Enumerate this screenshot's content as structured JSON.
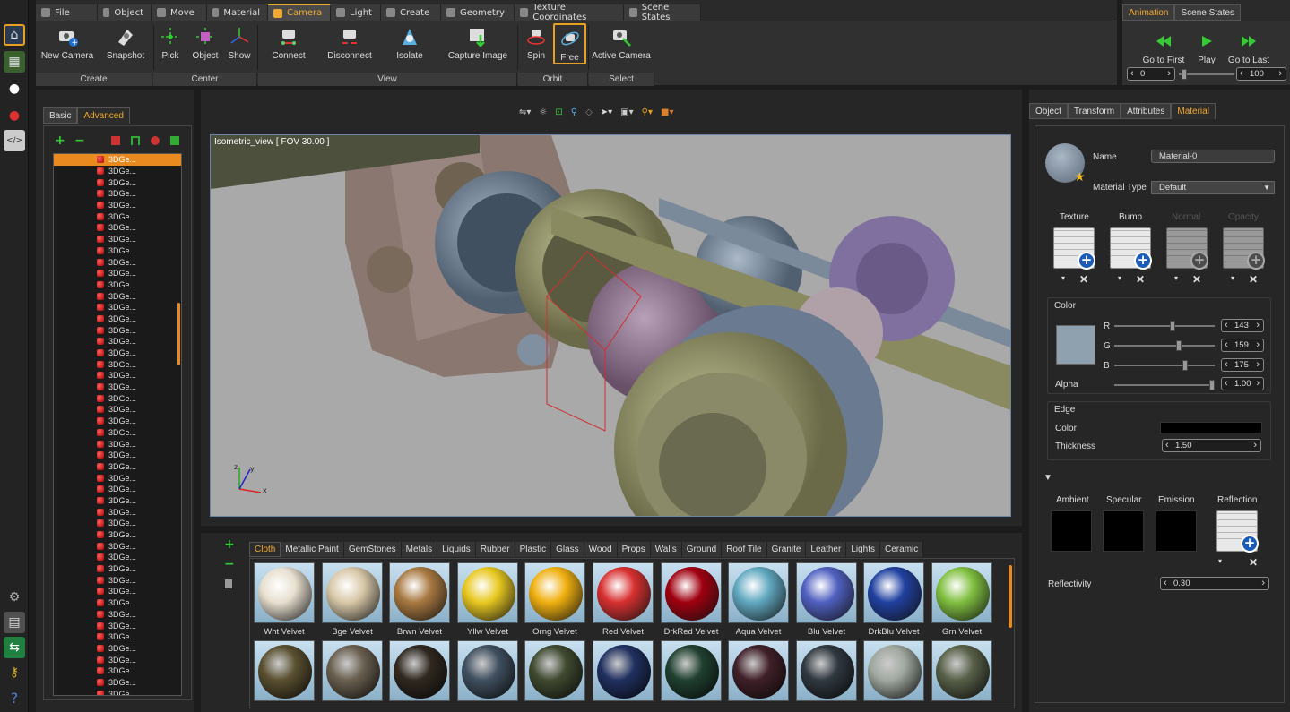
{
  "ribbon": {
    "tabs": [
      "File",
      "Object",
      "Move",
      "Material",
      "Camera",
      "Light",
      "Create",
      "Geometry",
      "Texture Coordinates",
      "Scene States"
    ],
    "active_tab": "Camera",
    "buttons": [
      "New Camera",
      "Snapshot",
      "Pick",
      "Object",
      "Show",
      "Connect",
      "Disconnect",
      "Isolate",
      "Capture Image",
      "Spin",
      "Free",
      "Active Camera"
    ],
    "groups": [
      "Create",
      "Center",
      "View",
      "Orbit",
      "Select"
    ]
  },
  "animation": {
    "tabs": [
      "Animation",
      "Scene States"
    ],
    "buttons": [
      "Go to First",
      "Play",
      "Go to Last"
    ],
    "start": "0",
    "end": "100"
  },
  "left_panel": {
    "tabs": [
      "Basic",
      "Advanced"
    ],
    "tree_item": "3DGe..."
  },
  "viewport": {
    "label": "Isometric_view [ FOV 30.00 ]",
    "axes": {
      "z": "z",
      "y": "y",
      "x": "x"
    }
  },
  "library": {
    "tabs": [
      "Cloth",
      "Metallic Paint",
      "GemStones",
      "Metals",
      "Liquids",
      "Rubber",
      "Plastic",
      "Glass",
      "Wood",
      "Props",
      "Walls",
      "Ground",
      "Roof Tile",
      "Granite",
      "Leather",
      "Lights",
      "Ceramic"
    ],
    "materials": [
      "Wht Velvet",
      "Bge Velvet",
      "Brwn Velvet",
      "Yllw Velvet",
      "Orng Velvet",
      "Red Velvet",
      "DrkRed Velvet",
      "Aqua Velvet",
      "Blu Velvet",
      "DrkBlu Velvet",
      "Grn Velvet"
    ],
    "colors_row1": [
      "#e8e0d0",
      "#d8c8a8",
      "#a87840",
      "#e8c820",
      "#f0b010",
      "#d83030",
      "#a00010",
      "#60a8c0",
      "#5060c0",
      "#2040a0",
      "#80c040"
    ],
    "colors_row2": [
      "#5a5030",
      "#6a6050",
      "#302820",
      "#405060",
      "#404a30",
      "#203060",
      "#204030",
      "#402028",
      "#303840",
      "#a0a8a0",
      "#586048"
    ]
  },
  "properties": {
    "tabs": [
      "Object",
      "Transform",
      "Attributes",
      "Material"
    ],
    "active_tab": "Material",
    "name_label": "Name",
    "name_value": "Material-0",
    "type_label": "Material Type",
    "type_value": "Default",
    "maps": [
      "Texture",
      "Bump",
      "Normal",
      "Opacity"
    ],
    "color_section": "Color",
    "color_swatch": "#8fa0af",
    "r_label": "R",
    "r_value": "143",
    "g_label": "G",
    "g_value": "159",
    "b_label": "B",
    "b_value": "175",
    "alpha_label": "Alpha",
    "alpha_value": "1.00",
    "edge_section": "Edge",
    "edge_color_label": "Color",
    "thickness_label": "Thickness",
    "thickness_value": "1.50",
    "channels": [
      "Ambient",
      "Specular",
      "Emission",
      "Reflection"
    ],
    "reflectivity_label": "Reflectivity",
    "reflectivity_value": "0.30"
  }
}
